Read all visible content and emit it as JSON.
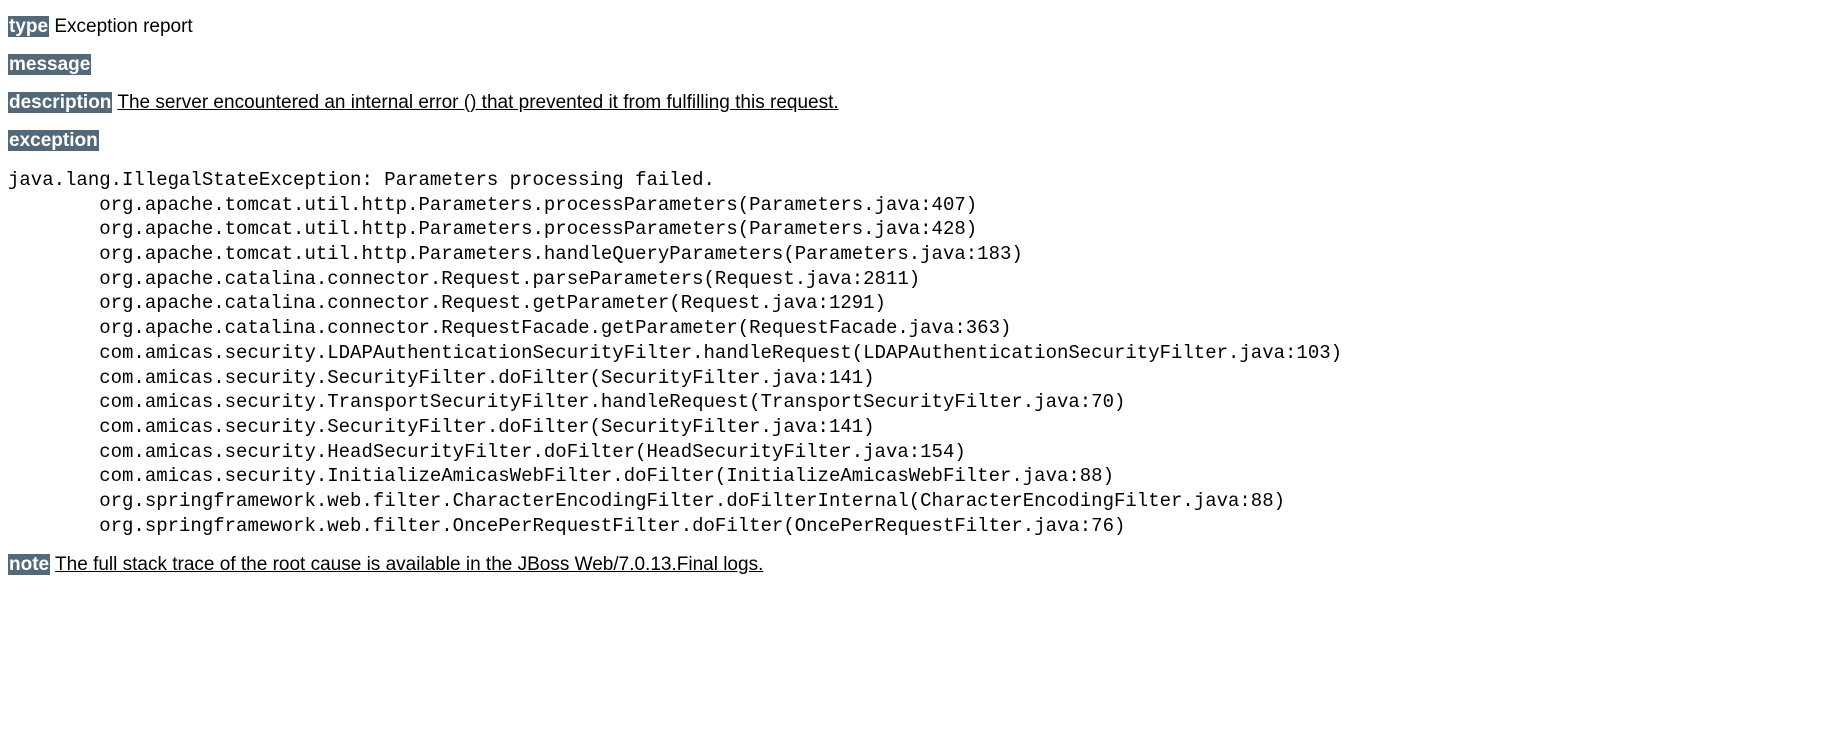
{
  "sections": {
    "type": {
      "label": "type",
      "value": "Exception report"
    },
    "message": {
      "label": "message",
      "value": ""
    },
    "description": {
      "label": "description",
      "value": "The server encountered an internal error () that prevented it from fulfilling this request."
    },
    "exception": {
      "label": "exception"
    },
    "note": {
      "label": "note",
      "value": "The full stack trace of the root cause is available in the JBoss Web/7.0.13.Final logs."
    }
  },
  "stacktrace": "java.lang.IllegalStateException: Parameters processing failed.\n\torg.apache.tomcat.util.http.Parameters.processParameters(Parameters.java:407)\n\torg.apache.tomcat.util.http.Parameters.processParameters(Parameters.java:428)\n\torg.apache.tomcat.util.http.Parameters.handleQueryParameters(Parameters.java:183)\n\torg.apache.catalina.connector.Request.parseParameters(Request.java:2811)\n\torg.apache.catalina.connector.Request.getParameter(Request.java:1291)\n\torg.apache.catalina.connector.RequestFacade.getParameter(RequestFacade.java:363)\n\tcom.amicas.security.LDAPAuthenticationSecurityFilter.handleRequest(LDAPAuthenticationSecurityFilter.java:103)\n\tcom.amicas.security.SecurityFilter.doFilter(SecurityFilter.java:141)\n\tcom.amicas.security.TransportSecurityFilter.handleRequest(TransportSecurityFilter.java:70)\n\tcom.amicas.security.SecurityFilter.doFilter(SecurityFilter.java:141)\n\tcom.amicas.security.HeadSecurityFilter.doFilter(HeadSecurityFilter.java:154)\n\tcom.amicas.security.InitializeAmicasWebFilter.doFilter(InitializeAmicasWebFilter.java:88)\n\torg.springframework.web.filter.CharacterEncodingFilter.doFilterInternal(CharacterEncodingFilter.java:88)\n\torg.springframework.web.filter.OncePerRequestFilter.doFilter(OncePerRequestFilter.java:76)"
}
